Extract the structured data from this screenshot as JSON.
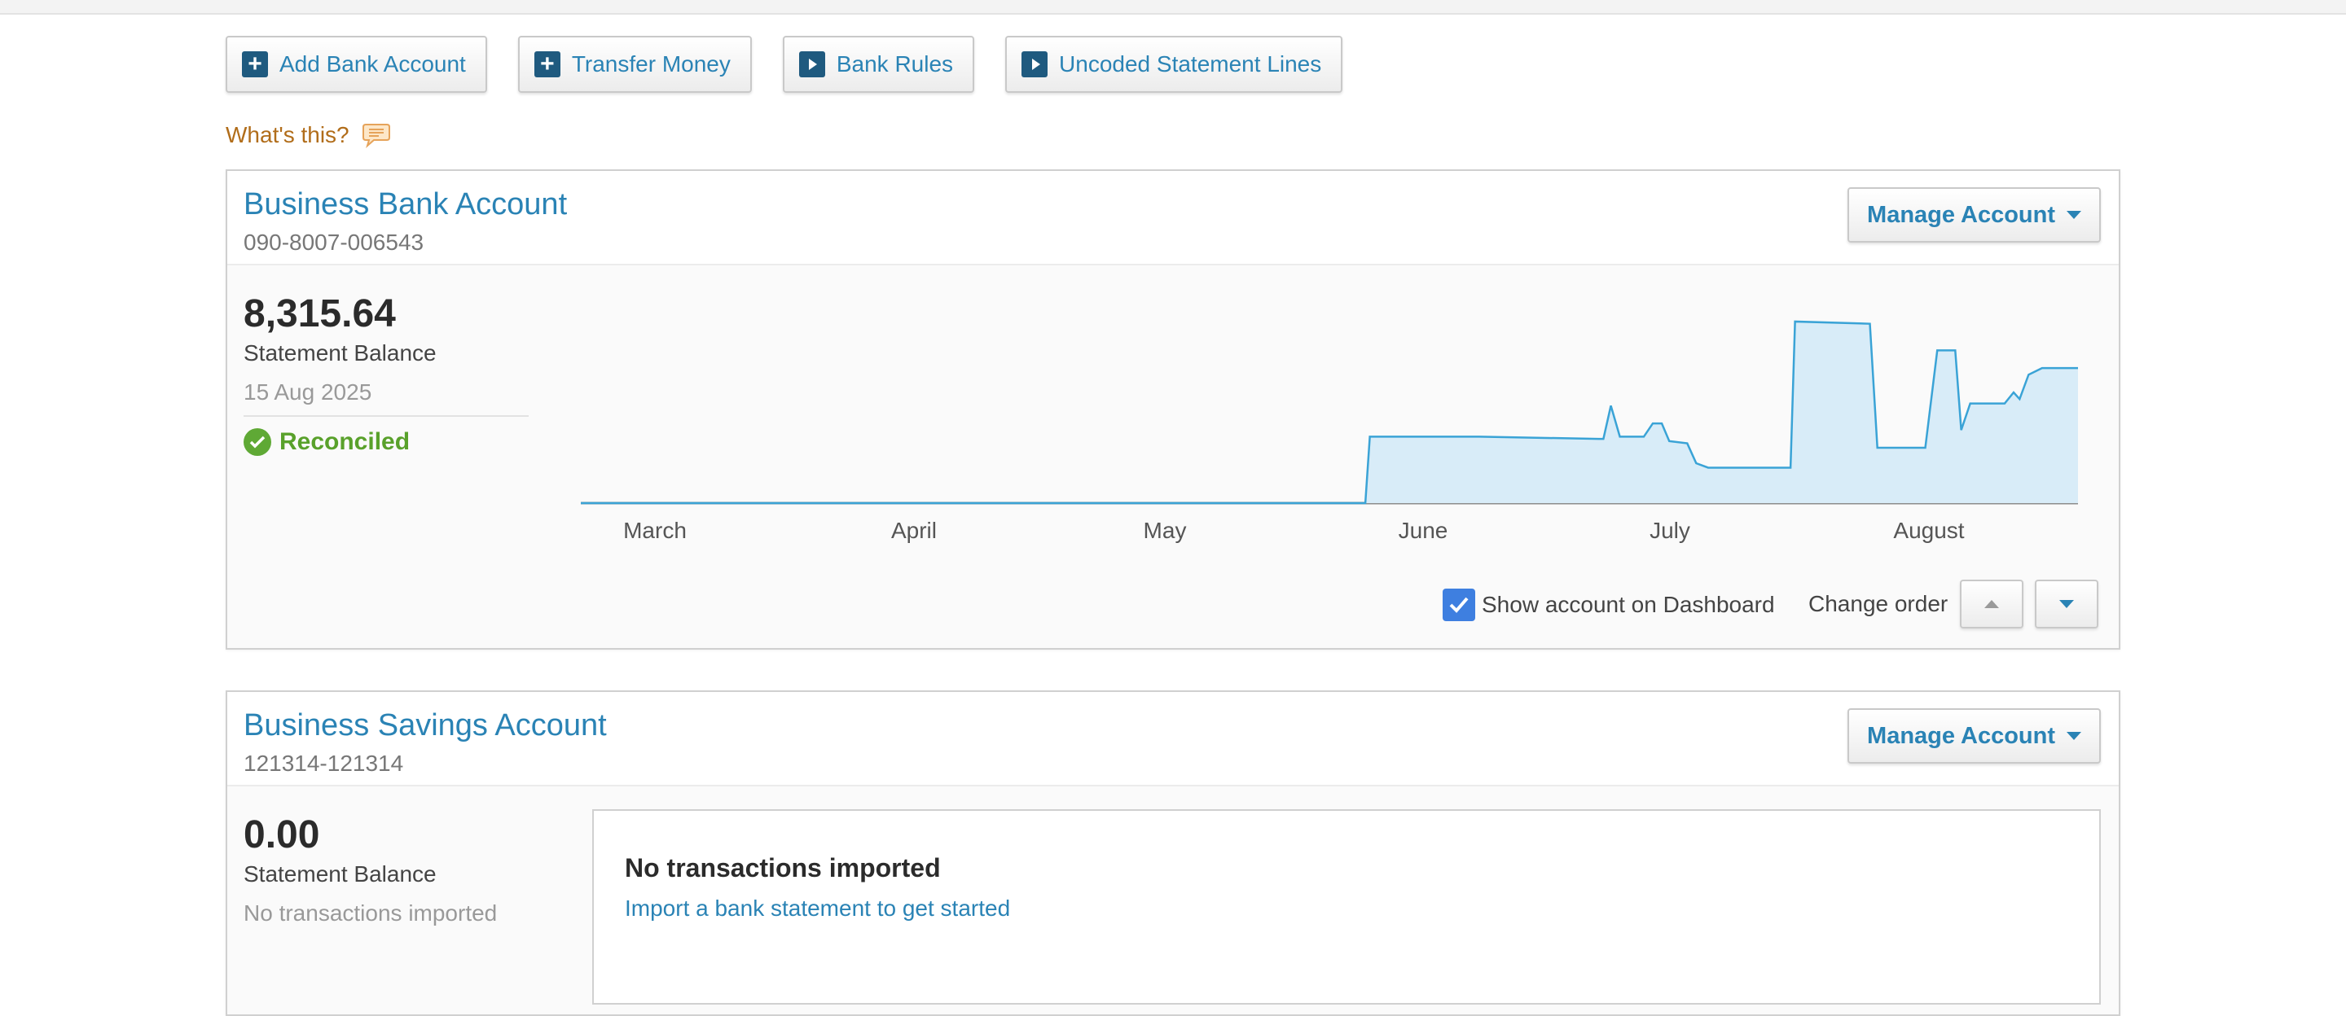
{
  "toolbar": {
    "add_bank_account": "Add Bank Account",
    "transfer_money": "Transfer Money",
    "bank_rules": "Bank Rules",
    "uncoded_statement_lines": "Uncoded Statement Lines"
  },
  "help": {
    "whats_this": "What's this?"
  },
  "accounts": [
    {
      "name": "Business Bank Account",
      "number": "090-8007-006543",
      "manage_label": "Manage Account",
      "balance": "8,315.64",
      "balance_label": "Statement Balance",
      "balance_date": "15 Aug 2025",
      "status": "Reconciled",
      "show_on_dashboard_label": "Show account on Dashboard",
      "show_on_dashboard": true,
      "change_order_label": "Change order"
    },
    {
      "name": "Business Savings Account",
      "number": "121314-121314",
      "manage_label": "Manage Account",
      "balance": "0.00",
      "balance_label": "Statement Balance",
      "balance_note": "No transactions imported",
      "empty_title": "No transactions imported",
      "empty_link": "Import a bank statement to get started"
    }
  ],
  "chart_data": {
    "type": "area",
    "title": "",
    "xlabel": "",
    "ylabel": "",
    "x_tick_labels": [
      "March",
      "April",
      "May",
      "June",
      "July",
      "August"
    ],
    "series": [
      {
        "color": "#3aa3d6",
        "fill": "#d8ecf8",
        "points": [
          [
            0,
            0
          ],
          [
            0.524,
            0
          ],
          [
            0.527,
            0.3
          ],
          [
            0.6,
            0.3
          ],
          [
            0.68,
            0.29
          ],
          [
            0.683,
            0.29
          ],
          [
            0.688,
            0.44
          ],
          [
            0.694,
            0.3
          ],
          [
            0.71,
            0.3
          ],
          [
            0.716,
            0.36
          ],
          [
            0.722,
            0.36
          ],
          [
            0.727,
            0.28
          ],
          [
            0.739,
            0.27
          ],
          [
            0.745,
            0.18
          ],
          [
            0.753,
            0.16
          ],
          [
            0.808,
            0.16
          ],
          [
            0.811,
            0.82
          ],
          [
            0.861,
            0.81
          ],
          [
            0.866,
            0.25
          ],
          [
            0.898,
            0.25
          ],
          [
            0.906,
            0.69
          ],
          [
            0.918,
            0.69
          ],
          [
            0.922,
            0.33
          ],
          [
            0.928,
            0.45
          ],
          [
            0.951,
            0.45
          ],
          [
            0.957,
            0.5
          ],
          [
            0.961,
            0.47
          ],
          [
            0.967,
            0.58
          ],
          [
            0.976,
            0.61
          ],
          [
            1.0,
            0.61
          ]
        ]
      }
    ],
    "grid": false,
    "legend": "none",
    "colors": {
      "line": "#3aa3d6",
      "fill": "#d8ecf8",
      "baseline": "#8c8c8c"
    }
  }
}
